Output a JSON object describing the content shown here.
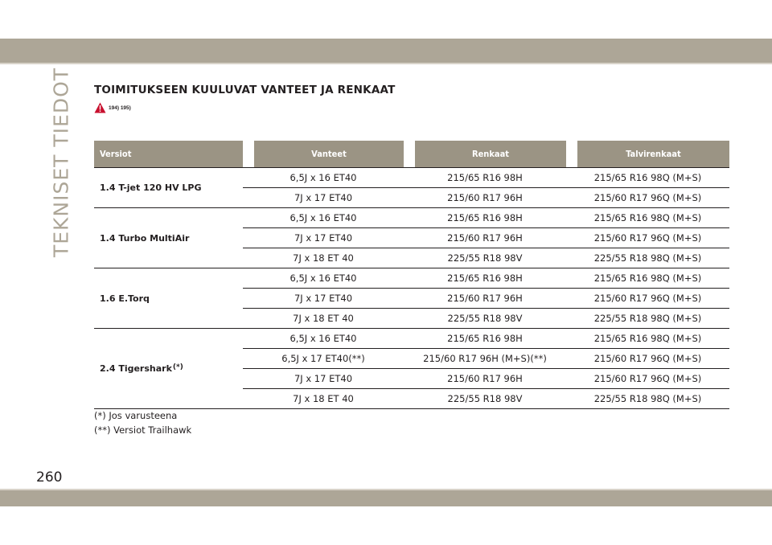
{
  "header": {
    "section_tab": "TEKNISET TIEDOT",
    "title": "TOIMITUKSEEN KUULUVAT VANTEET JA RENKAAT",
    "warning_refs": "194) 195)",
    "warning_icon": "warning-triangle-icon",
    "warning_color": "#c8102e"
  },
  "table": {
    "columns": [
      "Versiot",
      "Vanteet",
      "Renkaat",
      "Talvirenkaat"
    ],
    "groups": [
      {
        "version": "1.4 T-jet 120 HV LPG",
        "mark": "",
        "rows": [
          {
            "rim": "6,5J x 16 ET40",
            "tyre": "215/65 R16 98H",
            "winter": "215/65 R16 98Q (M+S)"
          },
          {
            "rim": "7J x 17 ET40",
            "tyre": "215/60 R17 96H",
            "winter": "215/60 R17 96Q (M+S)"
          }
        ]
      },
      {
        "version": "1.4 Turbo MultiAir",
        "mark": "",
        "rows": [
          {
            "rim": "6,5J x 16 ET40",
            "tyre": "215/65 R16 98H",
            "winter": "215/65 R16 98Q (M+S)"
          },
          {
            "rim": "7J x 17 ET40",
            "tyre": "215/60 R17 96H",
            "winter": "215/60 R17 96Q (M+S)"
          },
          {
            "rim": "7J x 18 ET 40",
            "tyre": "225/55 R18 98V",
            "winter": "225/55 R18 98Q (M+S)"
          }
        ]
      },
      {
        "version": "1.6 E.Torq",
        "mark": "",
        "rows": [
          {
            "rim": "6,5J x 16 ET40",
            "tyre": "215/65 R16 98H",
            "winter": "215/65 R16 98Q (M+S)"
          },
          {
            "rim": "7J x 17 ET40",
            "tyre": "215/60 R17 96H",
            "winter": "215/60 R17 96Q (M+S)"
          },
          {
            "rim": "7J x 18 ET 40",
            "tyre": "225/55 R18 98V",
            "winter": "225/55 R18 98Q (M+S)"
          }
        ]
      },
      {
        "version": "2.4 Tigershark",
        "mark": "(*)",
        "rows": [
          {
            "rim": "6,5J x 16 ET40",
            "tyre": "215/65 R16 98H",
            "winter": "215/65 R16 98Q (M+S)"
          },
          {
            "rim": "6,5J x 17 ET40",
            "rim_mark": "(**)",
            "tyre": "215/60 R17 96H (M+S)",
            "tyre_mark": "(**)",
            "winter": "215/60 R17 96Q (M+S)"
          },
          {
            "rim": "7J x 17 ET40",
            "tyre": "215/60 R17 96H",
            "winter": "215/60 R17 96Q (M+S)"
          },
          {
            "rim": "7J x 18 ET 40",
            "tyre": "225/55 R18 98V",
            "winter": "225/55 R18 98Q (M+S)"
          }
        ]
      }
    ]
  },
  "footnotes": [
    "(*) Jos varusteena",
    "(**) Versiot Trailhawk"
  ],
  "page_number": "260",
  "colors": {
    "band": "#ada697",
    "header_fill": "#9b9484",
    "text": "#231f20"
  }
}
